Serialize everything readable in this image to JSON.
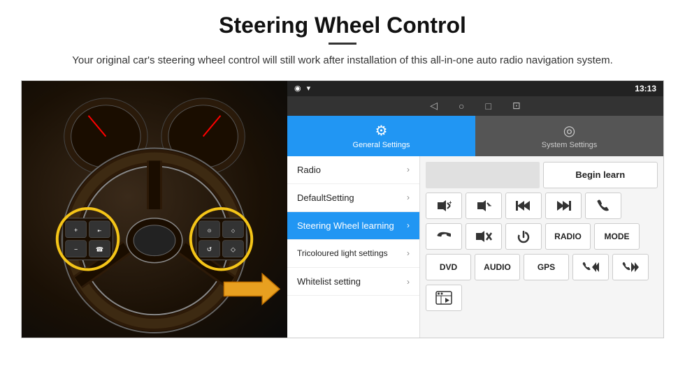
{
  "header": {
    "title": "Steering Wheel Control",
    "subtitle": "Your original car's steering wheel control will still work after installation of this all-in-one auto radio navigation system."
  },
  "status_bar": {
    "time": "13:13",
    "icons": [
      "◁",
      "○",
      "□",
      "⊡"
    ]
  },
  "tabs": [
    {
      "id": "general",
      "label": "General Settings",
      "icon": "⚙",
      "active": true
    },
    {
      "id": "system",
      "label": "System Settings",
      "icon": "◎",
      "active": false
    }
  ],
  "menu_items": [
    {
      "id": "radio",
      "label": "Radio",
      "active": false
    },
    {
      "id": "default",
      "label": "DefaultSetting",
      "active": false
    },
    {
      "id": "steering",
      "label": "Steering Wheel learning",
      "active": true
    },
    {
      "id": "tricoloured",
      "label": "Tricoloured light settings",
      "active": false
    },
    {
      "id": "whitelist",
      "label": "Whitelist setting",
      "active": false
    }
  ],
  "controls": {
    "begin_learn_label": "Begin learn",
    "buttons_row1": [
      "🔊+",
      "🔊−",
      "⏮",
      "⏭",
      "📞"
    ],
    "buttons_row2": [
      "📞↩",
      "🔊✕",
      "⏻",
      "RADIO",
      "MODE"
    ],
    "buttons_row3": [
      "DVD",
      "AUDIO",
      "GPS",
      "📞⏮",
      "📞⏭"
    ],
    "special_btn": "≡",
    "btn_labels": {
      "vol_up": "◄+",
      "vol_down": "◄−",
      "prev": "◄◄",
      "next": "►►",
      "call": "☎",
      "hang_up": "↩",
      "mute": "✕",
      "power": "⏻",
      "radio": "RADIO",
      "mode": "MODE",
      "dvd": "DVD",
      "audio": "AUDIO",
      "gps": "GPS"
    }
  }
}
